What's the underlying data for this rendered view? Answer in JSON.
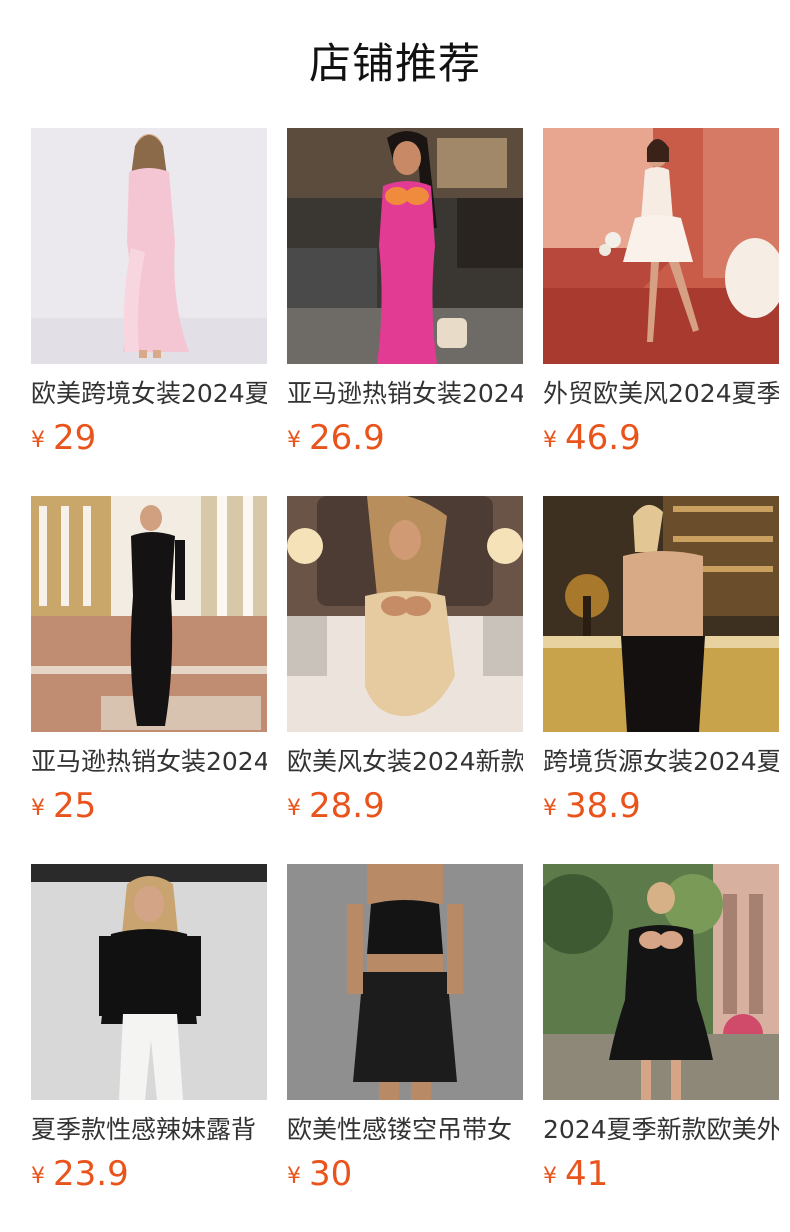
{
  "header": {
    "title": "店铺推荐"
  },
  "currency_symbol": "¥",
  "products": [
    {
      "title": "欧美跨境女装2024夏",
      "price": "29"
    },
    {
      "title": "亚马逊热销女装2024",
      "price": "26.9"
    },
    {
      "title": "外贸欧美风2024夏季",
      "price": "46.9"
    },
    {
      "title": "亚马逊热销女装2024",
      "price": "25"
    },
    {
      "title": "欧美风女装2024新款",
      "price": "28.9"
    },
    {
      "title": "跨境货源女装2024夏",
      "price": "38.9"
    },
    {
      "title": "夏季款性感辣妹露背",
      "price": "23.9"
    },
    {
      "title": "欧美性感镂空吊带女",
      "price": "30"
    },
    {
      "title": "2024夏季新款欧美外",
      "price": "41"
    }
  ]
}
